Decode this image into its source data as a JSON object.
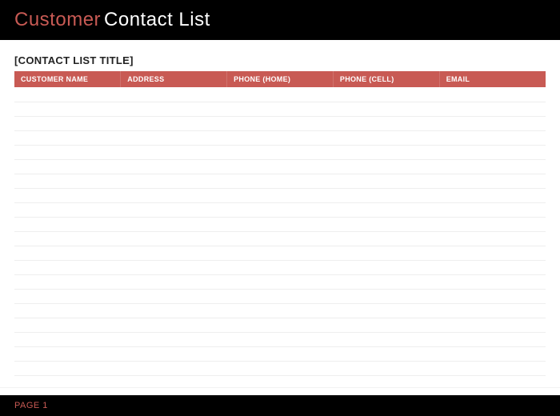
{
  "header": {
    "title_accent": "Customer",
    "title_rest": "Contact List"
  },
  "list_title": "[CONTACT LIST TITLE]",
  "columns": [
    "CUSTOMER NAME",
    "ADDRESS",
    "PHONE (HOME)",
    "PHONE (CELL)",
    "EMAIL"
  ],
  "rows": [
    {
      "name": "",
      "address": "",
      "phone_home": "",
      "phone_cell": "",
      "email": ""
    },
    {
      "name": "",
      "address": "",
      "phone_home": "",
      "phone_cell": "",
      "email": ""
    },
    {
      "name": "",
      "address": "",
      "phone_home": "",
      "phone_cell": "",
      "email": ""
    },
    {
      "name": "",
      "address": "",
      "phone_home": "",
      "phone_cell": "",
      "email": ""
    },
    {
      "name": "",
      "address": "",
      "phone_home": "",
      "phone_cell": "",
      "email": ""
    },
    {
      "name": "",
      "address": "",
      "phone_home": "",
      "phone_cell": "",
      "email": ""
    },
    {
      "name": "",
      "address": "",
      "phone_home": "",
      "phone_cell": "",
      "email": ""
    },
    {
      "name": "",
      "address": "",
      "phone_home": "",
      "phone_cell": "",
      "email": ""
    },
    {
      "name": "",
      "address": "",
      "phone_home": "",
      "phone_cell": "",
      "email": ""
    },
    {
      "name": "",
      "address": "",
      "phone_home": "",
      "phone_cell": "",
      "email": ""
    },
    {
      "name": "",
      "address": "",
      "phone_home": "",
      "phone_cell": "",
      "email": ""
    },
    {
      "name": "",
      "address": "",
      "phone_home": "",
      "phone_cell": "",
      "email": ""
    },
    {
      "name": "",
      "address": "",
      "phone_home": "",
      "phone_cell": "",
      "email": ""
    },
    {
      "name": "",
      "address": "",
      "phone_home": "",
      "phone_cell": "",
      "email": ""
    },
    {
      "name": "",
      "address": "",
      "phone_home": "",
      "phone_cell": "",
      "email": ""
    },
    {
      "name": "",
      "address": "",
      "phone_home": "",
      "phone_cell": "",
      "email": ""
    },
    {
      "name": "",
      "address": "",
      "phone_home": "",
      "phone_cell": "",
      "email": ""
    },
    {
      "name": "",
      "address": "",
      "phone_home": "",
      "phone_cell": "",
      "email": ""
    },
    {
      "name": "",
      "address": "",
      "phone_home": "",
      "phone_cell": "",
      "email": ""
    },
    {
      "name": "",
      "address": "",
      "phone_home": "",
      "phone_cell": "",
      "email": ""
    }
  ],
  "footer": {
    "page_label": "PAGE 1"
  },
  "colors": {
    "accent": "#c85a54",
    "header_bg": "#000000"
  }
}
